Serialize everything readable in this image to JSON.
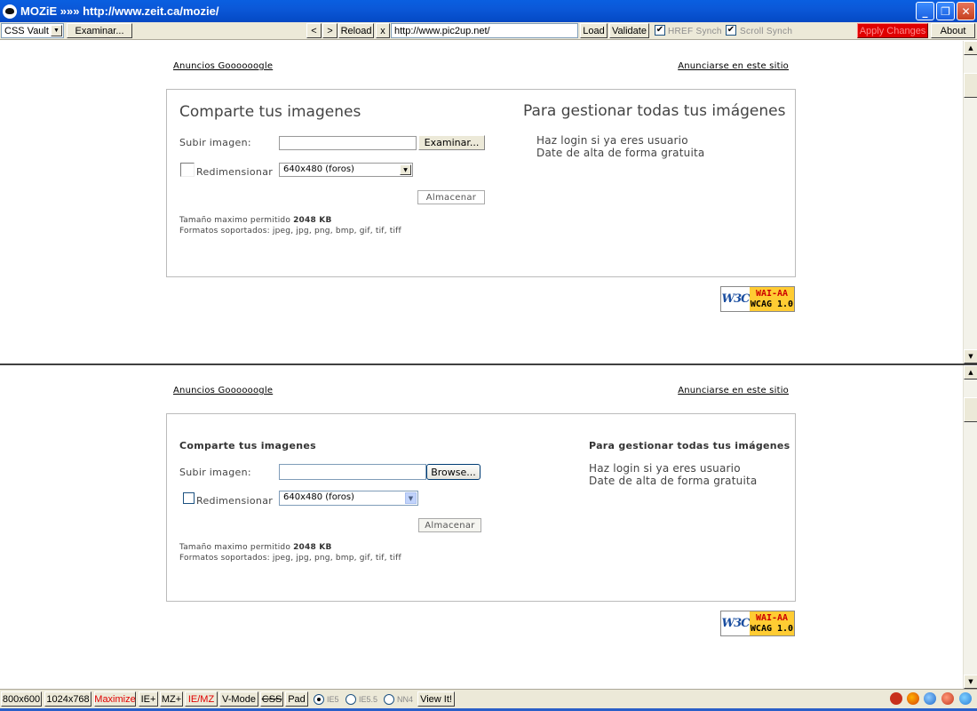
{
  "window": {
    "title": "MOZiE »»» http://www.zeit.ca/mozie/",
    "controls": {
      "minimize": "_",
      "maximize": "❐",
      "close": "✕"
    }
  },
  "toolbar": {
    "vault_select": "CSS Vault",
    "browse_label": "Examinar...",
    "back": "<",
    "forward": ">",
    "reload": "Reload",
    "clear": "x",
    "url": "http://www.pic2up.net/",
    "load": "Load",
    "validate": "Validate",
    "href_synch": "HREF Synch",
    "scroll_synch": "Scroll Synch",
    "apply": "Apply Changes",
    "about": "About",
    "href_checked": "✔",
    "scroll_checked": "✔"
  },
  "page": {
    "ad_left": "Anuncios Goooooogle",
    "ad_right": "Anunciarse en este sitio",
    "upload_heading": "Comparte tus imagenes",
    "manage_heading": "Para gestionar todas tus imágenes",
    "upload_label": "Subir imagen:",
    "resize_label": "Redimensionar",
    "resize_option": "640x480 (foros)",
    "store_button": "Almacenar",
    "max_size_prefix": "Tamaño maximo permitido",
    "max_size_value": "2048 KB",
    "formats": "Formatos soportados: jpeg, jpg, png, bmp, gif, tif, tiff",
    "login_link": "Haz login si ya eres usuario",
    "signup_link": "Date de alta de forma gratuita",
    "badge_w3c": "W3C",
    "badge_wai": "WAI-AA",
    "badge_wcag": "WCAG 1.0"
  },
  "pane_top": {
    "browse_button": "Examinar..."
  },
  "pane_bottom": {
    "browse_button": "Browse..."
  },
  "bottombar": {
    "size1": "800x600",
    "size2": "1024x768",
    "maximize": "Maximize",
    "ie_plus": "IE+",
    "mz_plus": "MZ+",
    "ie_mz": "IE/MZ",
    "vmode": "V-Mode",
    "css": "CSS",
    "pad": "Pad",
    "radio_ie5": "IE5",
    "radio_ie55": "IE5.5",
    "radio_nn4": "NN4",
    "view": "View It!"
  },
  "colors": {
    "titlebar": "#0b58d8",
    "apply_bg": "#e00000",
    "wai_badge": "#ffcc33"
  }
}
